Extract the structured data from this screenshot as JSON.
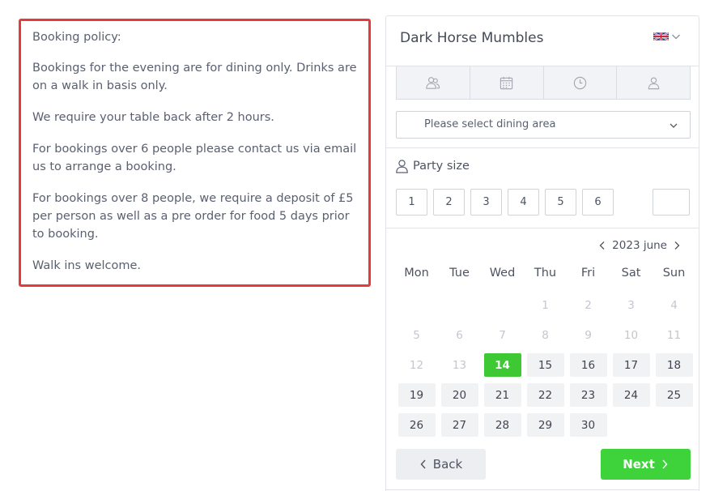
{
  "policy": {
    "heading": "Booking policy:",
    "paragraphs": [
      "Bookings for the evening are for dining only. Drinks are on a walk in basis only.",
      "We require your table back after 2 hours.",
      "For bookings over 6 people please contact us via email us to arrange a booking.",
      "For bookings over 8 people, we require a deposit of £5 per person as well as a pre order for food 5 days prior to booking.",
      "Walk ins welcome."
    ]
  },
  "widget": {
    "venue": "Dark Horse Mumbles",
    "language_icon": "uk-flag-icon",
    "steps": [
      {
        "icon": "guests-icon"
      },
      {
        "icon": "calendar-icon"
      },
      {
        "icon": "clock-icon"
      },
      {
        "icon": "user-icon"
      }
    ],
    "dining_area": {
      "placeholder": "Please select dining area"
    },
    "party": {
      "label": "Party size",
      "sizes": [
        "1",
        "2",
        "3",
        "4",
        "5",
        "6"
      ],
      "other_value": ""
    },
    "calendar": {
      "month_label": "2023 june",
      "weekdays": [
        "Mon",
        "Tue",
        "Wed",
        "Thu",
        "Fri",
        "Sat",
        "Sun"
      ],
      "days": [
        {
          "d": "",
          "s": "empty"
        },
        {
          "d": "",
          "s": "empty"
        },
        {
          "d": "",
          "s": "empty"
        },
        {
          "d": "1",
          "s": "dis"
        },
        {
          "d": "2",
          "s": "dis"
        },
        {
          "d": "3",
          "s": "dis"
        },
        {
          "d": "4",
          "s": "dis"
        },
        {
          "d": "5",
          "s": "dis"
        },
        {
          "d": "6",
          "s": "dis"
        },
        {
          "d": "7",
          "s": "dis"
        },
        {
          "d": "8",
          "s": "dis"
        },
        {
          "d": "9",
          "s": "dis"
        },
        {
          "d": "10",
          "s": "dis"
        },
        {
          "d": "11",
          "s": "dis"
        },
        {
          "d": "12",
          "s": "dis"
        },
        {
          "d": "13",
          "s": "dis"
        },
        {
          "d": "14",
          "s": "sel"
        },
        {
          "d": "15",
          "s": "av"
        },
        {
          "d": "16",
          "s": "av"
        },
        {
          "d": "17",
          "s": "av"
        },
        {
          "d": "18",
          "s": "av"
        },
        {
          "d": "19",
          "s": "av"
        },
        {
          "d": "20",
          "s": "av"
        },
        {
          "d": "21",
          "s": "av"
        },
        {
          "d": "22",
          "s": "av"
        },
        {
          "d": "23",
          "s": "av"
        },
        {
          "d": "24",
          "s": "av"
        },
        {
          "d": "25",
          "s": "av"
        },
        {
          "d": "26",
          "s": "av"
        },
        {
          "d": "27",
          "s": "av"
        },
        {
          "d": "28",
          "s": "av"
        },
        {
          "d": "29",
          "s": "av"
        },
        {
          "d": "30",
          "s": "av"
        }
      ]
    },
    "back_label": "Back",
    "next_label": "Next"
  },
  "colors": {
    "policy_border": "#e5393b",
    "accent_green": "#3fd33b",
    "selected_day": "#3ec834",
    "text": "#4d5360"
  }
}
